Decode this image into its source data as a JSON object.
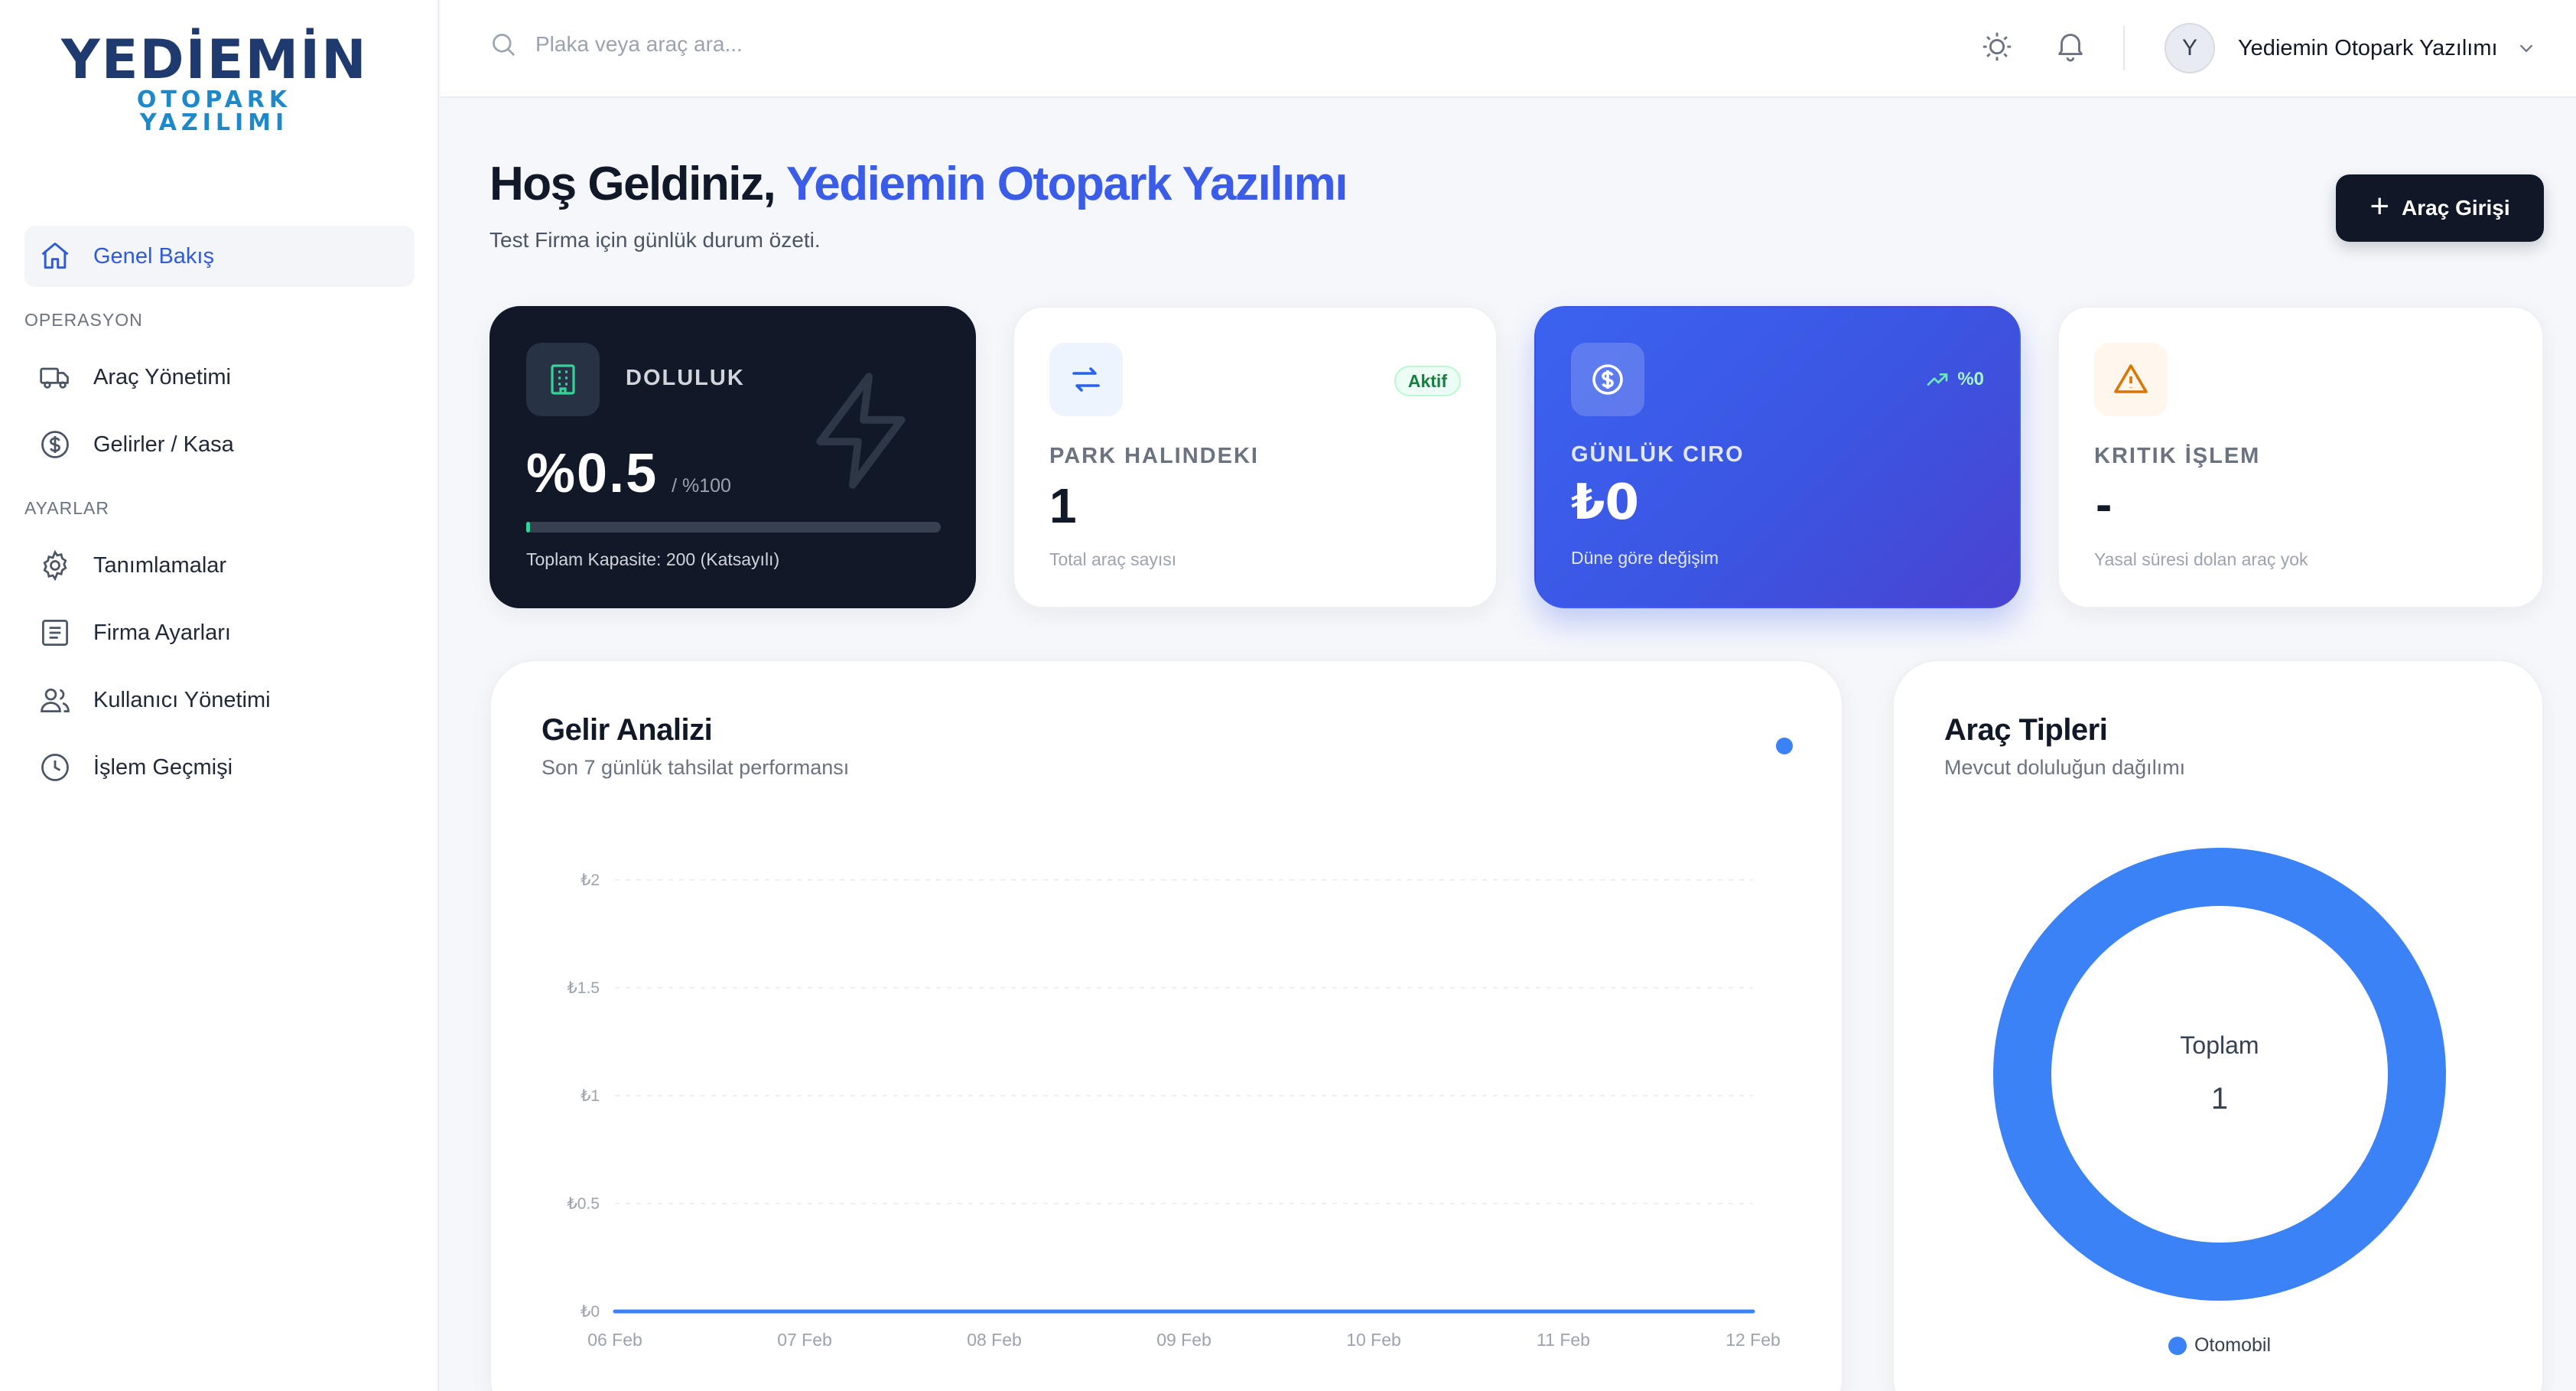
{
  "brand": {
    "main": "YEDİEMİN",
    "sub": "OTOPARK YAZILIMI"
  },
  "sidebar": {
    "home": {
      "label": "Genel Bakış",
      "icon": "home-icon"
    },
    "sections": [
      {
        "title": "OPERASYON",
        "items": [
          {
            "label": "Araç Yönetimi",
            "icon": "truck-icon"
          },
          {
            "label": "Gelirler / Kasa",
            "icon": "dollar-circle-icon"
          }
        ]
      },
      {
        "title": "AYARLAR",
        "items": [
          {
            "label": "Tanımlamalar",
            "icon": "gear-icon"
          },
          {
            "label": "Firma Ayarları",
            "icon": "document-icon"
          },
          {
            "label": "Kullanıcı Yönetimi",
            "icon": "users-icon"
          },
          {
            "label": "İşlem Geçmişi",
            "icon": "clock-icon"
          }
        ]
      }
    ]
  },
  "header": {
    "search_placeholder": "Plaka veya araç ara...",
    "user": {
      "initial": "Y",
      "name": "Yediemin Otopark Yazılımı"
    }
  },
  "welcome": {
    "greeting": "Hoş Geldiniz,",
    "name": "Yediemin Otopark Yazılımı",
    "subtitle": "Test Firma için günlük durum özeti."
  },
  "actions": {
    "vehicle_entry": "Araç Girişi"
  },
  "stats": {
    "occupancy": {
      "label": "DOLULUK",
      "value": "%0.5",
      "suffix": "/ %100",
      "note": "Toplam Kapasite: 200 (Katsayılı)",
      "progress": 0.005
    },
    "parked": {
      "label": "PARK HALINDEKI",
      "badge": "Aktif",
      "value": "1",
      "note": "Total araç sayısı"
    },
    "revenue": {
      "label": "GÜNLÜK CIRO",
      "change": "%0",
      "value": "₺0",
      "note": "Düne göre değişim"
    },
    "critical": {
      "label": "KRITIK İŞLEM",
      "value": "-",
      "note": "Yasal süresi dolan araç yok"
    }
  },
  "revenue_panel": {
    "title": "Gelir Analizi",
    "subtitle": "Son 7 günlük tahsilat performansı"
  },
  "types_panel": {
    "title": "Araç Tipleri",
    "subtitle": "Mevcut doluluğun dağılımı",
    "center_label": "Toplam",
    "center_value": "1"
  },
  "colors": {
    "accent": "#3b5ce6",
    "dark": "#111827",
    "series": "#3b82f6",
    "success": "#16a34a",
    "warning": "#d97706"
  },
  "chart_data": [
    {
      "type": "line",
      "x": [
        "06 Feb",
        "07 Feb",
        "08 Feb",
        "09 Feb",
        "10 Feb",
        "11 Feb",
        "12 Feb"
      ],
      "series": [
        {
          "values": [
            0,
            0,
            0,
            0,
            0,
            0,
            0
          ]
        }
      ],
      "yticks": [
        "₺0",
        "₺0.5",
        "₺1",
        "₺1.5",
        "₺2"
      ],
      "ytick_values": [
        0,
        0.5,
        1,
        1.5,
        2
      ],
      "ylim": [
        0,
        2
      ],
      "grid": true
    },
    {
      "type": "pie",
      "categories": [
        "Otomobil"
      ],
      "values": [
        1
      ],
      "legend": "bottom"
    }
  ]
}
